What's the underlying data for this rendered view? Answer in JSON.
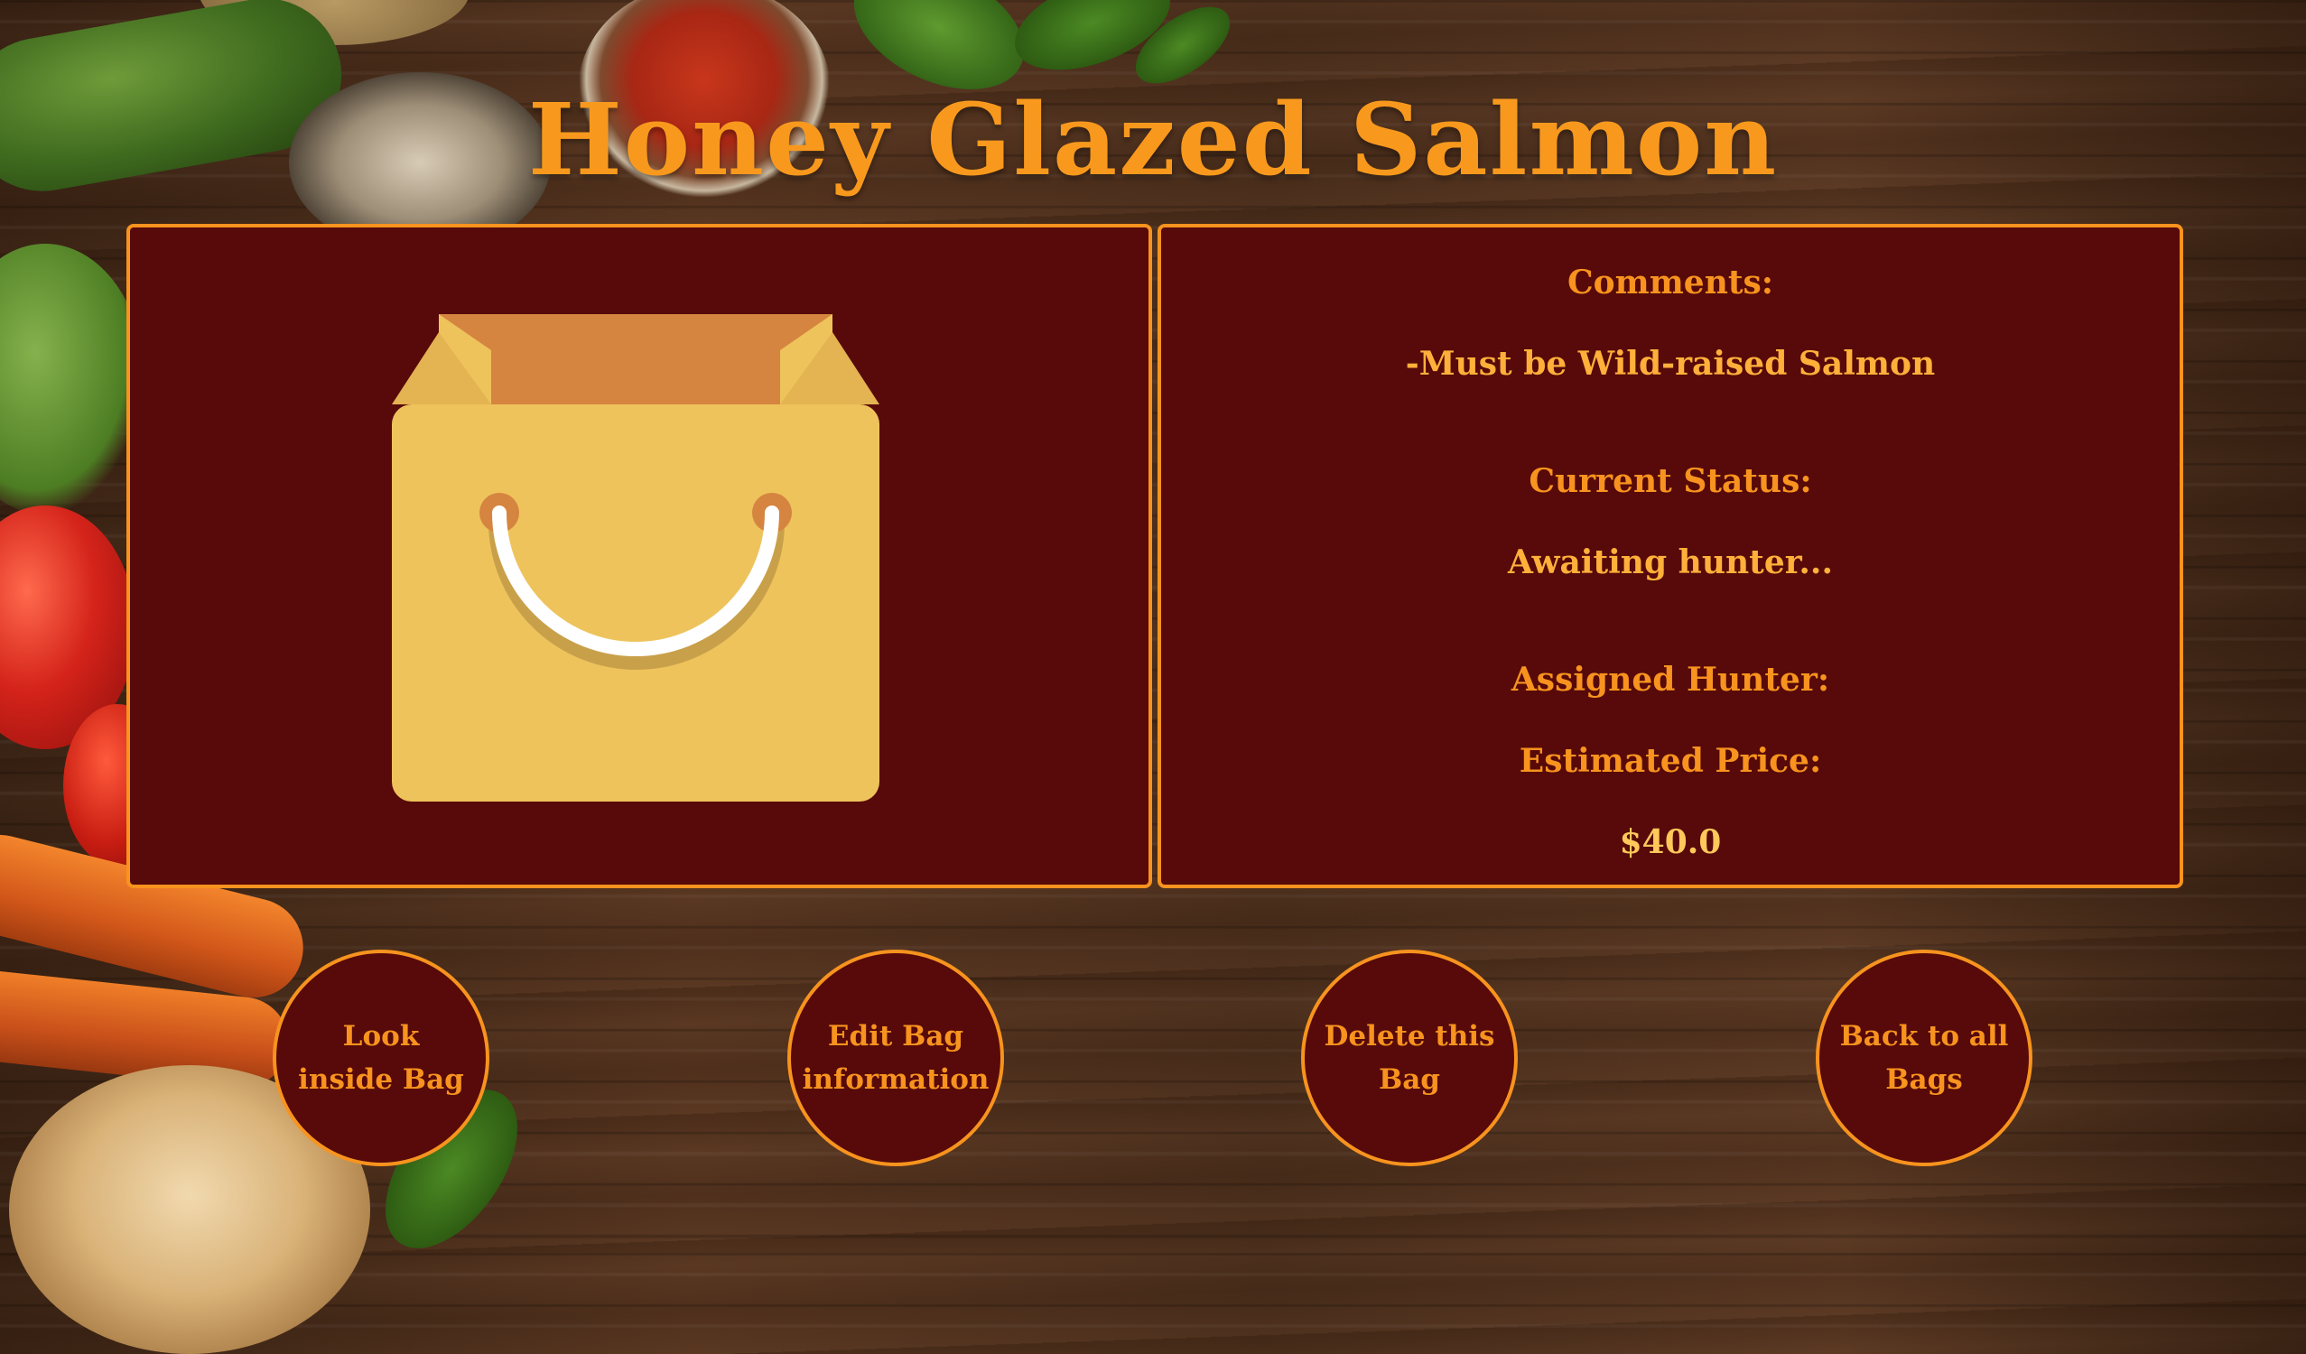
{
  "page": {
    "title": "Honey Glazed Salmon"
  },
  "details": {
    "comments_label": "Comments:",
    "comments_value": "-Must be Wild-raised Salmon",
    "status_label": "Current Status:",
    "status_value": "Awaiting hunter...",
    "hunter_label": "Assigned Hunter:",
    "price_label": "Estimated Price:",
    "price_value": "$40.0"
  },
  "image": {
    "icon": "shopping-bag-icon"
  },
  "actions": [
    {
      "label": "Look inside Bag"
    },
    {
      "label": "Edit Bag information"
    },
    {
      "label": "Delete this Bag"
    },
    {
      "label": "Back to all Bags"
    }
  ],
  "colors": {
    "accent": "#f7931e",
    "panel": "#570a09",
    "bag_body": "#eec35c",
    "bag_top": "#d5853f",
    "handle": "#ffffff"
  }
}
